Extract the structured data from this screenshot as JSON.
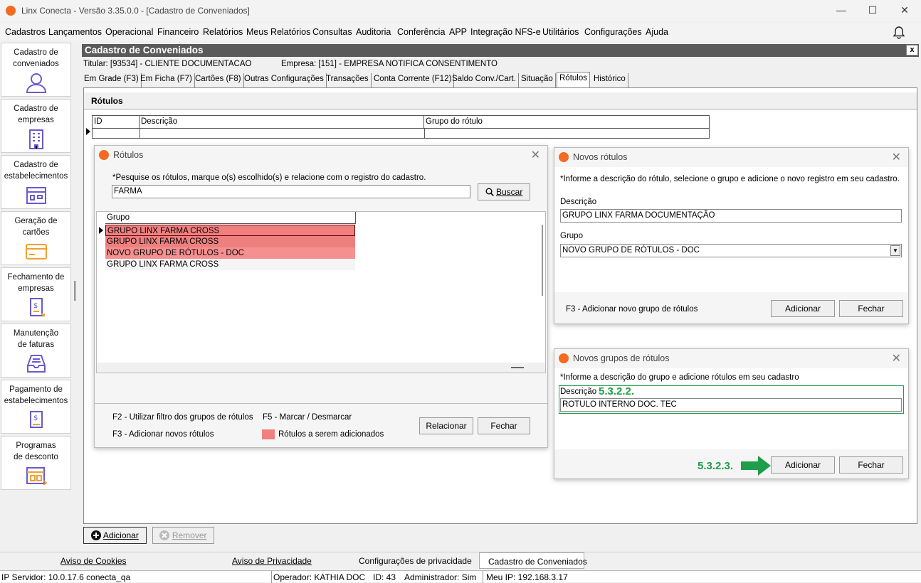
{
  "window": {
    "title": "Linx Conecta - Versão 3.35.0.0 - [Cadastro de Conveniados]"
  },
  "menu": [
    "Cadastros",
    "Lançamentos",
    "Operacional",
    "Financeiro",
    "Relatórios",
    "Meus Relatórios",
    "Consultas",
    "Auditoria",
    "Conferência",
    "APP",
    "Integração NFS-e",
    "Utilitários",
    "Configurações",
    "Ajuda"
  ],
  "sidebar": [
    {
      "line1": "Cadastro de",
      "line2": "conveniados",
      "icon": "user-icon"
    },
    {
      "line1": "Cadastro de",
      "line2": "empresas",
      "icon": "building-icon"
    },
    {
      "line1": "Cadastro de",
      "line2": "estabelecimentos",
      "icon": "store-icon"
    },
    {
      "line1": "Geração de",
      "line2": "cartões",
      "icon": "card-icon"
    },
    {
      "line1": "Fechamento de",
      "line2": "empresas",
      "icon": "invoice-icon"
    },
    {
      "line1": "Manutenção",
      "line2": "de faturas",
      "icon": "tray-icon"
    },
    {
      "line1": "Pagamento de",
      "line2": "estabelecimentos",
      "icon": "payment-icon"
    },
    {
      "line1": "Programas",
      "line2": "de desconto",
      "icon": "discount-icon"
    }
  ],
  "form": {
    "title": "Cadastro de Conveniados",
    "close": "x",
    "titular": "Titular: [93534] - CLIENTE DOCUMENTACAO",
    "empresa": "Empresa: [151] - EMPRESA NOTIFICA CONSENTIMENTO",
    "tabs": [
      "Em Grade (F3)",
      "Em Ficha (F7)",
      "Cartões (F8)",
      "Outras Configurações",
      "Transações",
      "Conta Corrente (F12)",
      "Saldo Conv./Cart.",
      "Situação",
      "Rótulos",
      "Histórico"
    ],
    "section": "Rótulos",
    "grid_headers": [
      "ID",
      "Descrição",
      "Grupo do rótulo"
    ],
    "add_button": "Adicionar",
    "remove_button": "Remover"
  },
  "dlg_rotulos": {
    "title": "Rótulos",
    "hint": "*Pesquise os rótulos, marque o(s) escolhido(s) e relacione com o registro do cadastro.",
    "search_value": "FARMA",
    "search_button": "Buscar",
    "col_grupo": "Grupo",
    "rows": [
      "GRUPO LINX  FARMA CROSS",
      "GRUPO LINX  FARMA CROSS",
      "NOVO GRUPO DE RÓTULOS - DOC",
      "GRUPO LINX  FARMA CROSS"
    ],
    "f2": "F2 - Utilizar filtro dos grupos de rótulos",
    "dash": "-",
    "f5": "F5 - Marcar / Desmarcar",
    "f3": "F3 - Adicionar novos rótulos",
    "legend": "Rótulos a serem adicionados",
    "relacionar": "Relacionar",
    "fechar": "Fechar",
    "highlight_color": "#f08080"
  },
  "dlg_novos": {
    "title": "Novos rótulos",
    "hint": "*Informe a descrição do rótulo, selecione o grupo e adicione o novo registro em seu cadastro.",
    "desc_label": "Descrição",
    "desc_value": "GRUPO LINX FARMA DOCUMENTAÇÃO",
    "grupo_label": "Grupo",
    "grupo_value": "NOVO GRUPO DE RÓTULOS - DOC",
    "f3": "F3 - Adicionar novo grupo de rótulos",
    "adicionar": "Adicionar",
    "fechar": "Fechar"
  },
  "dlg_grupos": {
    "title": "Novos grupos de rótulos",
    "hint": "*Informe a descrição do grupo e adicione rótulos em seu cadastro",
    "desc_label": "Descrição",
    "annot1": "5.3.2.2.",
    "desc_value": "ROTULO INTERNO DOC. TEC",
    "annot2": "5.3.2.3.",
    "adicionar": "Adicionar",
    "fechar": "Fechar",
    "annot_color": "#1e9e4a"
  },
  "statusbar": {
    "cookies": "Aviso de Cookies",
    "privacidade": "Aviso de Privacidade",
    "config": "Configurações de privacidade",
    "current": "Cadastro de Conveniados"
  },
  "infobar": {
    "servidor": "IP Servidor: 10.0.17.6 conecta_qa",
    "operador": "Operador: KATHIA DOC",
    "id": "ID: 43",
    "admin": "Administrador: Sim",
    "meuip": "Meu IP: 192.168.3.17"
  }
}
